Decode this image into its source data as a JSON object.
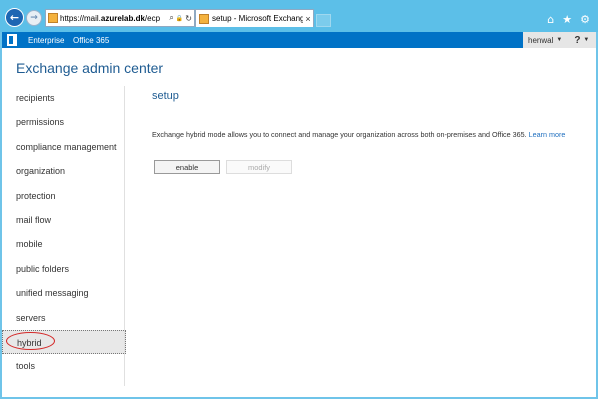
{
  "browser": {
    "address_url_prefix": "https://mail.",
    "address_url_host": "azurelab.dk",
    "address_url_suffix": "/ecp",
    "tab_title": "setup - Microsoft Exchange",
    "tab_close": "×",
    "back_glyph": "←",
    "forward_glyph": "→",
    "search_glyph": "⌕",
    "refresh_glyph": "↻",
    "lock_glyph": "🔒",
    "home_glyph": "⌂",
    "favorites_glyph": "★",
    "settings_glyph": "⚙"
  },
  "topbar": {
    "enterprise": "Enterprise",
    "office365": "Office 365",
    "user": "henwal",
    "user_caret": "▼",
    "help": "?",
    "help_caret": "▼"
  },
  "page": {
    "title": "Exchange admin center"
  },
  "sidebar": {
    "items": [
      {
        "label": "recipients"
      },
      {
        "label": "permissions"
      },
      {
        "label": "compliance management"
      },
      {
        "label": "organization"
      },
      {
        "label": "protection"
      },
      {
        "label": "mail flow"
      },
      {
        "label": "mobile"
      },
      {
        "label": "public folders"
      },
      {
        "label": "unified messaging"
      },
      {
        "label": "servers"
      },
      {
        "label": "hybrid"
      },
      {
        "label": "tools"
      }
    ],
    "selected": "hybrid"
  },
  "main": {
    "section_title": "setup",
    "description": "Exchange hybrid mode allows you to connect and manage your organization across both on-premises and Office 365.",
    "learn_more": "Learn more",
    "enable_label": "enable",
    "modify_label": "modify"
  },
  "colors": {
    "brand_blue": "#0072c6",
    "title_blue": "#1f5c92",
    "highlight_ring": "#d42a2a"
  }
}
